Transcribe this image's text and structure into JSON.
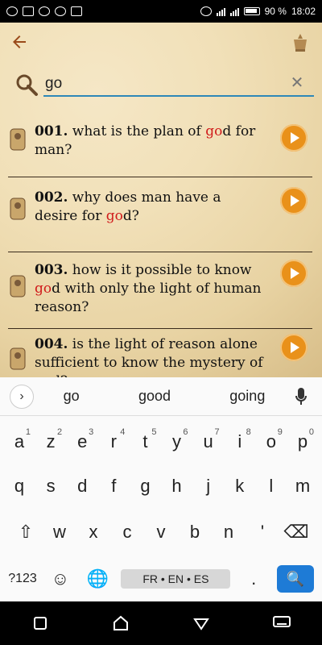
{
  "status": {
    "battery": "90 %",
    "time": "18:02"
  },
  "toolbar": {
    "back_icon": "arrow-left-icon",
    "logo_icon": "papal-emblem-icon"
  },
  "search": {
    "value": "go"
  },
  "list": [
    {
      "num": "001.",
      "pre": " what is the plan of ",
      "hl": "go",
      "post": "d for man?"
    },
    {
      "num": "002.",
      "pre": " why does man have a desire for ",
      "hl": "go",
      "post": "d?"
    },
    {
      "num": "003.",
      "pre": " how is it possible to know ",
      "hl": "go",
      "post": "d with only the light of human reason?"
    },
    {
      "num": "004.",
      "pre": " is the light of reason alone sufficient to know the mystery of ",
      "hl": "go",
      "post": "d?"
    }
  ],
  "keyboard": {
    "suggestions": [
      "go",
      "good",
      "going"
    ],
    "row1": [
      {
        "k": "a",
        "s": "1"
      },
      {
        "k": "z",
        "s": "2"
      },
      {
        "k": "e",
        "s": "3"
      },
      {
        "k": "r",
        "s": "4"
      },
      {
        "k": "t",
        "s": "5"
      },
      {
        "k": "y",
        "s": "6"
      },
      {
        "k": "u",
        "s": "7"
      },
      {
        "k": "i",
        "s": "8"
      },
      {
        "k": "o",
        "s": "9"
      },
      {
        "k": "p",
        "s": "0"
      }
    ],
    "row2": [
      "q",
      "s",
      "d",
      "f",
      "g",
      "h",
      "j",
      "k",
      "l",
      "m"
    ],
    "row3": [
      "⇧",
      "w",
      "x",
      "c",
      "v",
      "b",
      "n",
      "'",
      "⌫"
    ],
    "bottom": {
      "sym": "?123",
      "emoji": "☺",
      "globe": "🌐",
      "space": "FR • EN • ES",
      "dot": ".",
      "search": "🔍"
    }
  },
  "colors": {
    "highlight": "#d01c1c",
    "accent": "#e9911a"
  }
}
